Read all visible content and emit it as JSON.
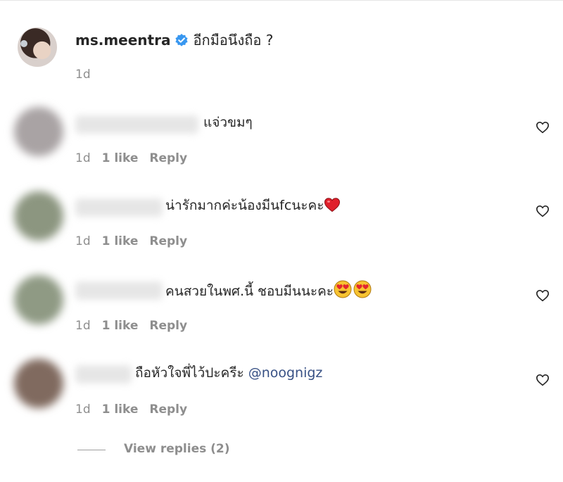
{
  "caption": {
    "username": "ms.meentra",
    "verified_icon": "verified-badge-icon",
    "text": "อีกมือนึงถือ ?",
    "time": "1d"
  },
  "comments": [
    {
      "text": "แจ่วขมๆ",
      "mention": "",
      "time": "1d",
      "likes": "1 like",
      "reply": "Reply",
      "avatar_color": "#a9a3a4"
    },
    {
      "text": "น่ารักมากค่ะน้องมีนfcนะคะ",
      "mention": "",
      "time": "1d",
      "likes": "1 like",
      "reply": "Reply",
      "emoji": "red-heart",
      "avatar_color": "#8c9680"
    },
    {
      "text": "คนสวยในพศ.นี้ ชอบมีนนะคะ",
      "mention": "",
      "time": "1d",
      "likes": "1 like",
      "reply": "Reply",
      "emoji": "heart-eyes-x2",
      "avatar_color": "#8f9a84"
    },
    {
      "text": "ถือหัวใจพี่ไว้ปะครีะ ",
      "mention": "@noognigz",
      "time": "1d",
      "likes": "1 like",
      "reply": "Reply",
      "avatar_color": "#806a5f"
    }
  ],
  "view_replies": "View replies (2)",
  "icons": {
    "like": "heart-outline-icon"
  },
  "colors": {
    "text": "#262626",
    "secondary": "#8e8e8e",
    "mention": "#385185",
    "verified": "#3897f0"
  }
}
